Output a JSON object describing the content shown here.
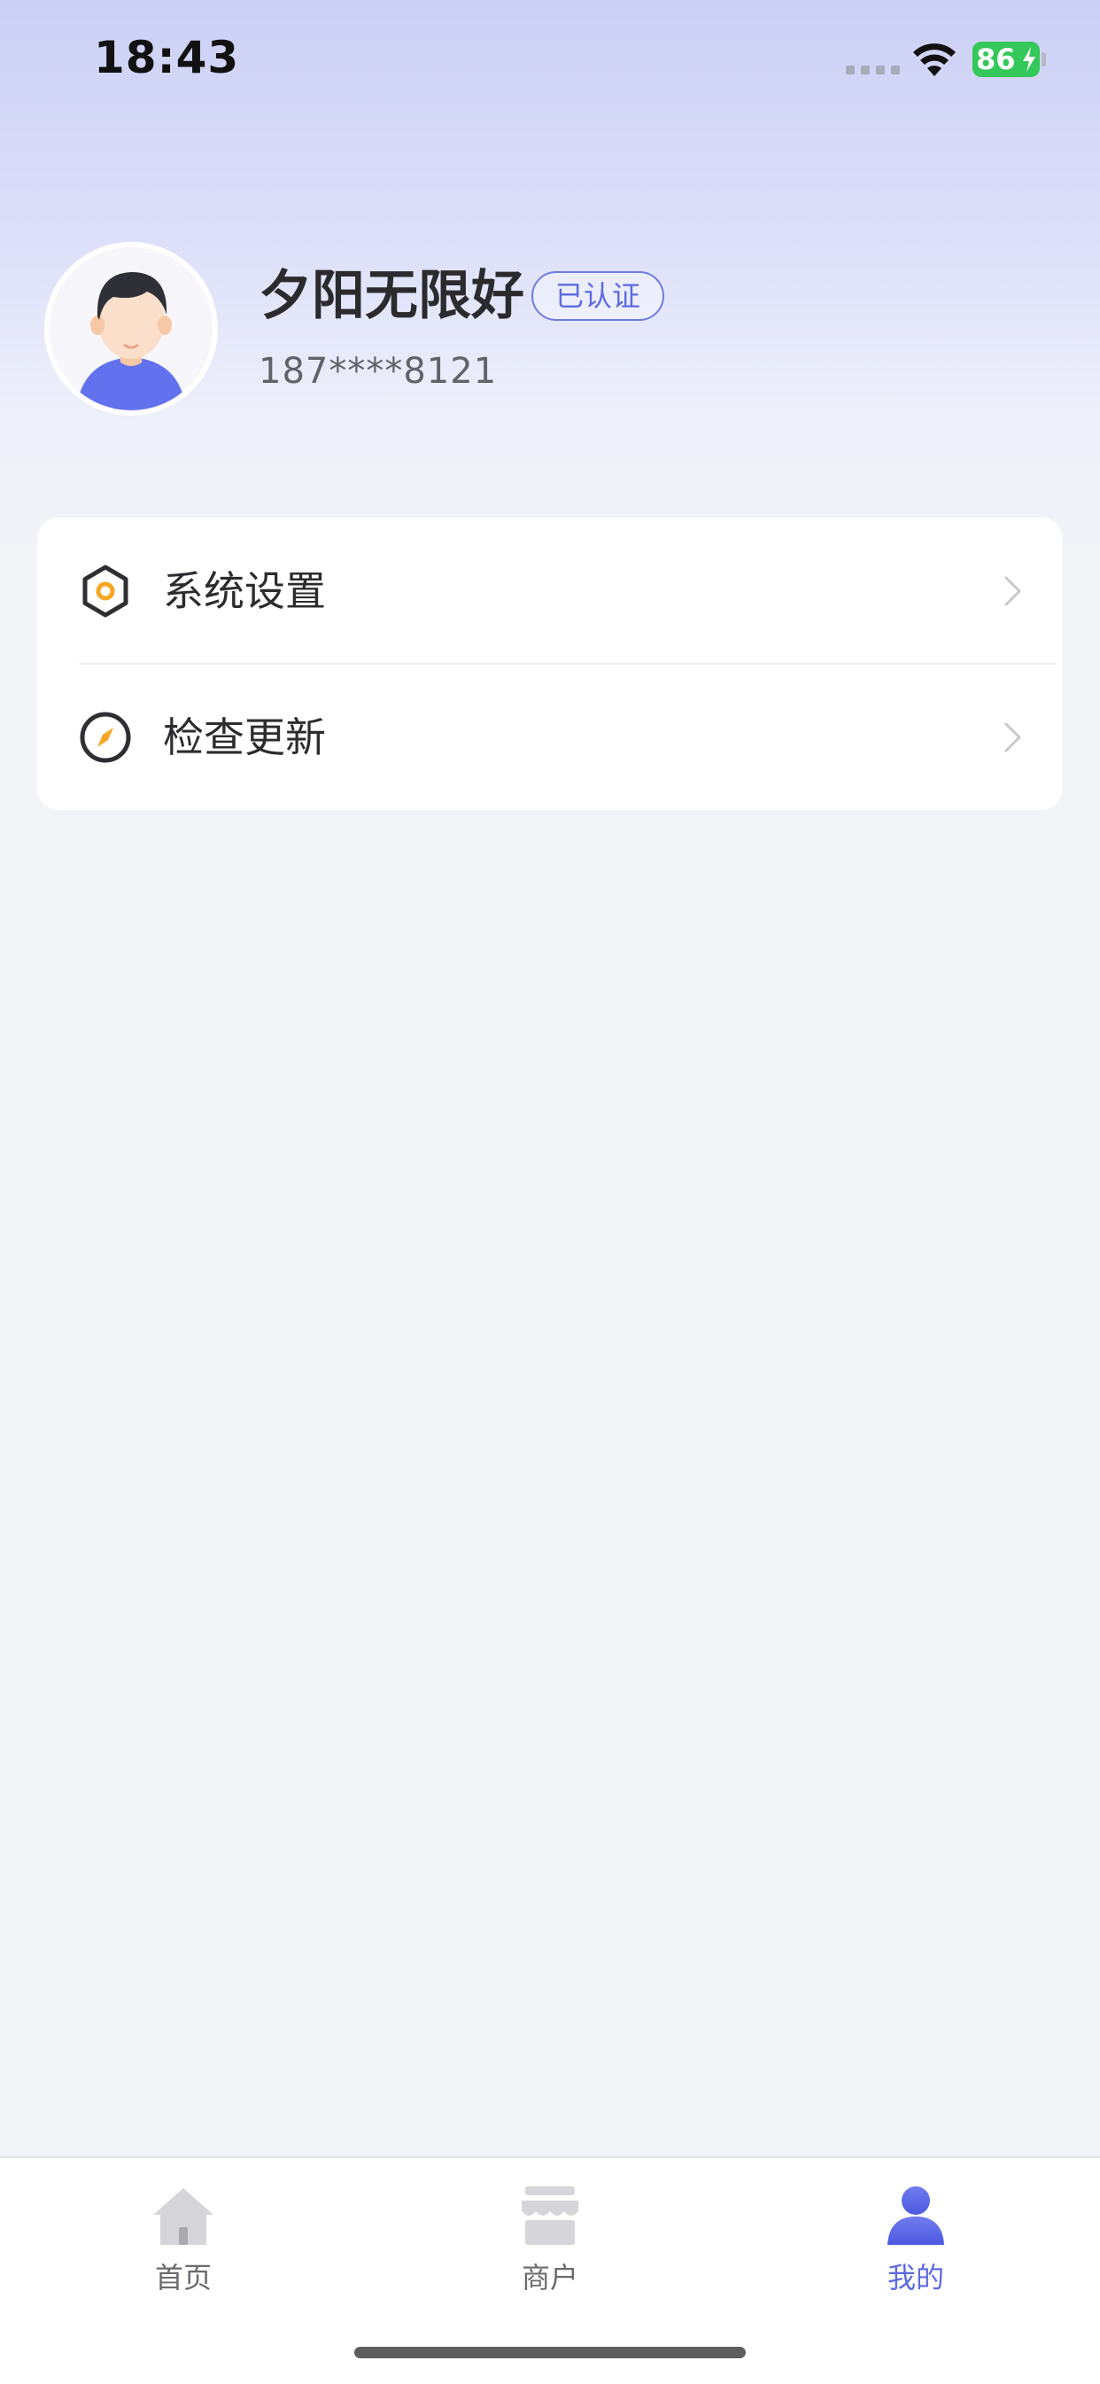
{
  "status_bar": {
    "time": "18:43",
    "battery_percent": "86",
    "icons": [
      "signal-icon",
      "wifi-icon",
      "battery-icon",
      "charging-bolt-icon"
    ]
  },
  "profile": {
    "name": "夕阳无限好",
    "badge": "已认证",
    "phone": "187****8121",
    "avatar_icon": "avatar-icon"
  },
  "menu": {
    "items": [
      {
        "label": "系统设置",
        "icon": "settings-hex-icon"
      },
      {
        "label": "检查更新",
        "icon": "compass-icon"
      }
    ]
  },
  "tab_bar": {
    "tabs": [
      {
        "label": "首页",
        "icon": "home-icon",
        "active": false
      },
      {
        "label": "商户",
        "icon": "shop-icon",
        "active": false
      },
      {
        "label": "我的",
        "icon": "person-icon",
        "active": true
      }
    ]
  },
  "colors": {
    "accent": "#5d6ae2",
    "badge_border": "#6f7de0",
    "battery_green": "#34c759",
    "icon_orange": "#f5a623",
    "page_background": "#f3f4f7"
  }
}
